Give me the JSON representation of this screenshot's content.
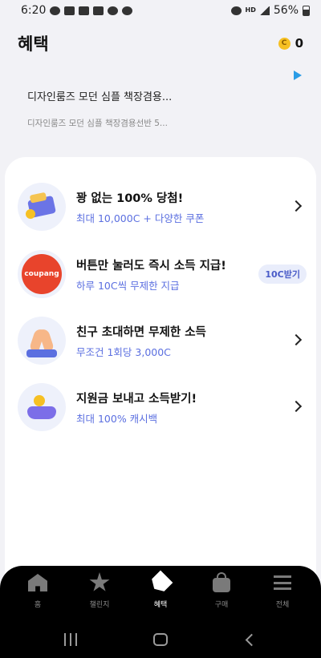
{
  "status_bar": {
    "time": "6:20",
    "battery": "56%",
    "network": "HD"
  },
  "header": {
    "title": "혜택",
    "coin_symbol": "C",
    "coin_count": "0"
  },
  "ad": {
    "title": "디자인룸즈 모던 심플 책장겸용...",
    "subtitle": "디자인룸즈 모던 심플 책장겸용선반 5..."
  },
  "benefits": [
    {
      "title": "꽝 없는 100% 당첨!",
      "subtitle": "최대 10,000C + 다양한 쿠폰",
      "icon": "wallet-icon",
      "action": "chevron"
    },
    {
      "title": "버튼만 눌러도 즉시 소득 지급!",
      "subtitle": "하루 10C씩 무제한 지급",
      "icon": "coupang-icon",
      "icon_text": "coupang",
      "action_label": "10C받기"
    },
    {
      "title": "친구 초대하면 무제한 소득",
      "subtitle": "무조건 1회당 3,000C",
      "icon": "high-five-icon",
      "action": "chevron"
    },
    {
      "title": "지원금 보내고 소득받기!",
      "subtitle": "최대 100% 캐시백",
      "icon": "hand-coin-icon",
      "action": "chevron"
    }
  ],
  "nav": [
    {
      "label": "홈",
      "icon": "home-icon"
    },
    {
      "label": "챌린지",
      "icon": "star-icon"
    },
    {
      "label": "혜택",
      "icon": "tag-icon",
      "active": true
    },
    {
      "label": "구매",
      "icon": "shopping-bag-icon"
    },
    {
      "label": "전체",
      "icon": "menu-icon"
    }
  ],
  "colors": {
    "accent": "#5b6fe0",
    "coin": "#f6c023",
    "nav_bg": "#000000",
    "coupang": "#e8442c"
  }
}
